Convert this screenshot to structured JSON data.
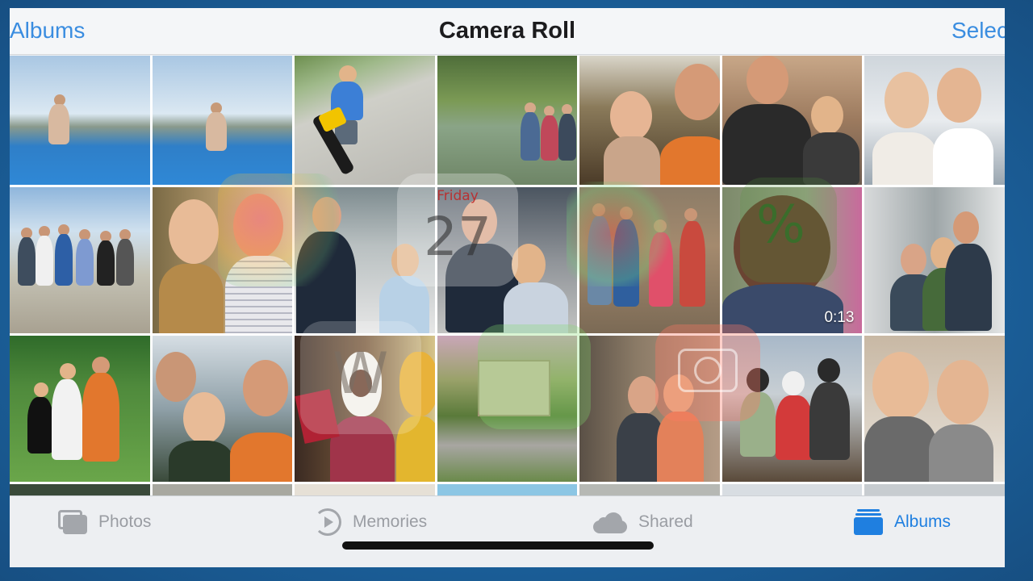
{
  "nav": {
    "back_label": "Albums",
    "title": "Camera Roll",
    "select_label": "Selec"
  },
  "grid": {
    "video_duration": "0:13",
    "calendar_day_label": "Friday",
    "calendar_day_number": "27"
  },
  "tabbar": {
    "tabs": [
      {
        "label": "Photos",
        "icon": "photos-stack-icon",
        "active": false
      },
      {
        "label": "Memories",
        "icon": "memories-icon",
        "active": false
      },
      {
        "label": "Shared",
        "icon": "cloud-icon",
        "active": false
      },
      {
        "label": "Albums",
        "icon": "albums-icon",
        "active": true
      }
    ]
  },
  "colors": {
    "accent": "#3a8de0",
    "active_tab": "#1f7fe0",
    "inactive_tab": "#9a9da3"
  }
}
